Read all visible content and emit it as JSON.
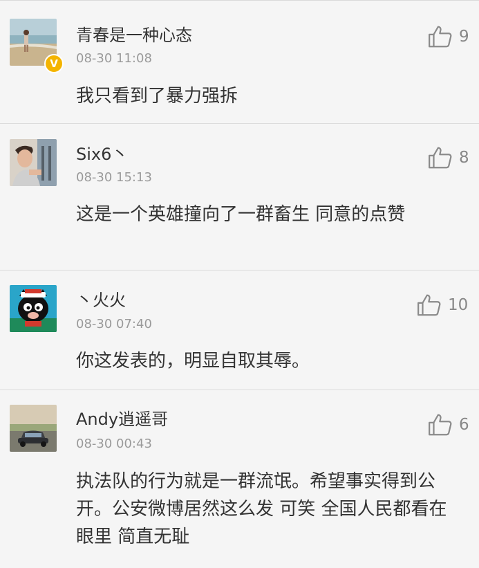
{
  "comments": [
    {
      "username": "青春是一种心态",
      "verified_mark": "V",
      "time": "08-30 11:08",
      "text": "我只看到了暴力强拆",
      "likes": "9",
      "avatar_icon": "beach-photo-avatar"
    },
    {
      "username": "Six6丶",
      "time": "08-30 15:13",
      "text": "这是一个英雄撞向了一群畜生 同意的点赞",
      "likes": "8",
      "avatar_icon": "person-photo-avatar"
    },
    {
      "username": "丶火火",
      "time": "08-30 07:40",
      "text": "你这发表的，明显自取其辱。",
      "likes": "10",
      "avatar_icon": "black-cat-cartoon-avatar"
    },
    {
      "username": "Andy逍遥哥",
      "time": "08-30 00:43",
      "text": "执法队的行为就是一群流氓。希望事实得到公开。公安微博居然这么发 可笑 全国人民都看在眼里 简直无耻",
      "likes": "6",
      "avatar_icon": "car-photo-avatar"
    }
  ],
  "colors": {
    "background": "#f5f5f5",
    "divider": "#dcdcdc",
    "verified_badge": "#f4b400",
    "text_primary": "#333333",
    "text_secondary": "#9a9a9a"
  }
}
